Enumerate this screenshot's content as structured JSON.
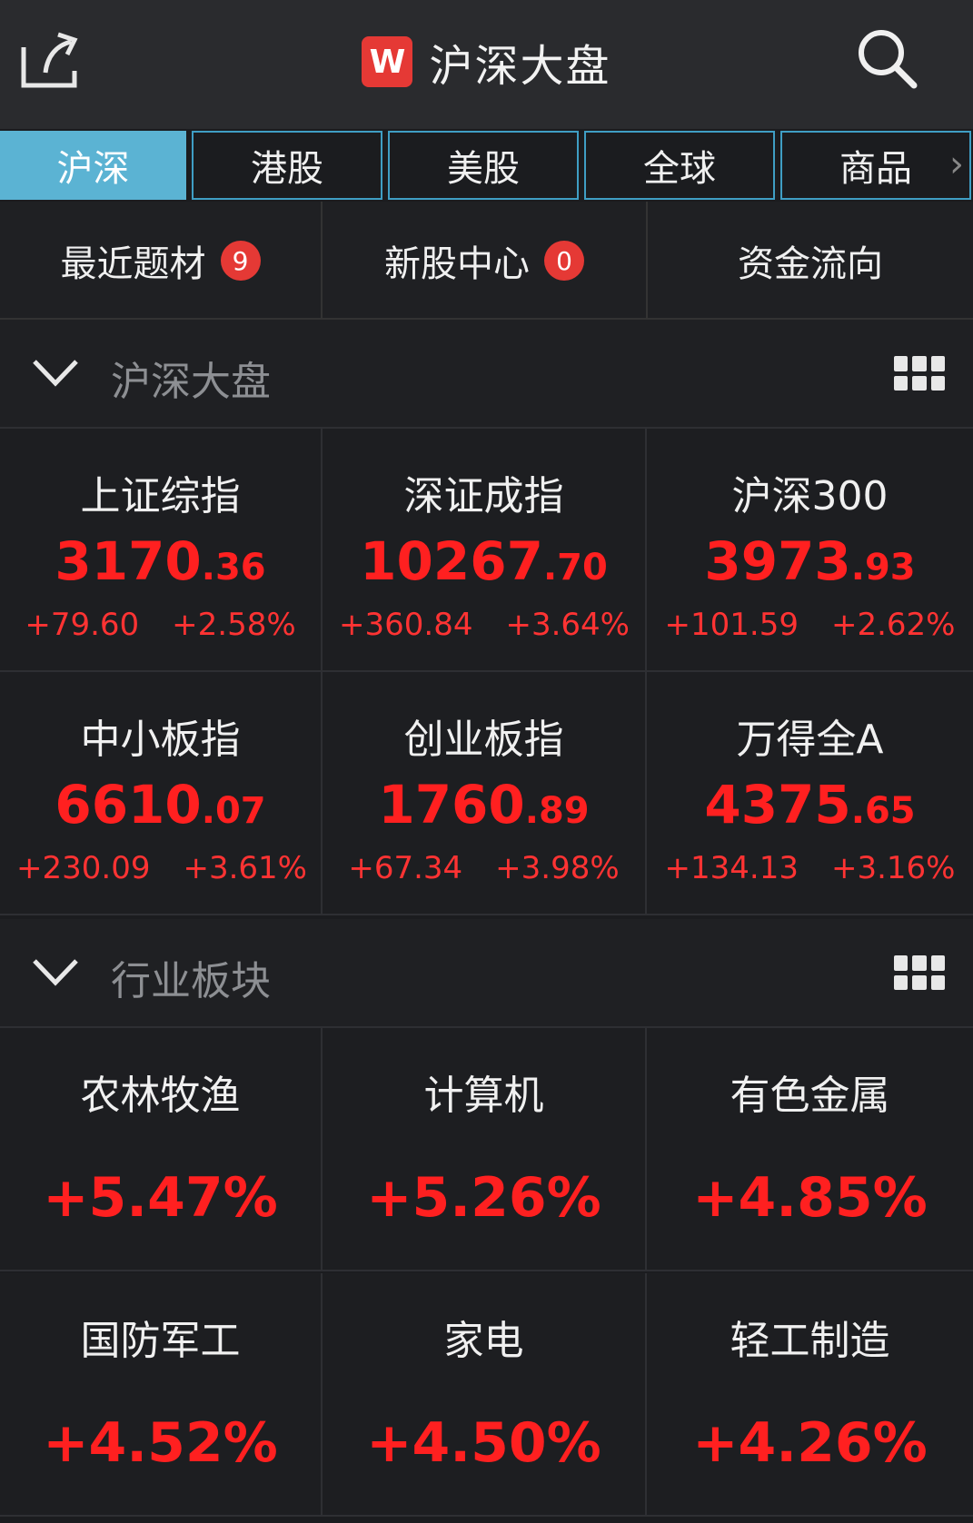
{
  "header": {
    "title": "沪深大盘",
    "logo_text": "W",
    "share_icon": "share-icon",
    "search_icon": "search-icon"
  },
  "tabs": [
    {
      "label": "沪深",
      "active": true
    },
    {
      "label": "港股",
      "active": false
    },
    {
      "label": "美股",
      "active": false
    },
    {
      "label": "全球",
      "active": false
    },
    {
      "label": "商品",
      "active": false
    }
  ],
  "quick_links": [
    {
      "label": "最近题材",
      "badge": "9"
    },
    {
      "label": "新股中心",
      "badge": "0"
    },
    {
      "label": "资金流向",
      "badge": null
    }
  ],
  "market_section": {
    "title": "沪深大盘",
    "indices": [
      {
        "name": "上证综指",
        "value_int": "3170",
        "value_dec": ".36",
        "change": "+79.60",
        "change_pct": "+2.58%"
      },
      {
        "name": "深证成指",
        "value_int": "10267",
        "value_dec": ".70",
        "change": "+360.84",
        "change_pct": "+3.64%"
      },
      {
        "name": "沪深300",
        "value_int": "3973",
        "value_dec": ".93",
        "change": "+101.59",
        "change_pct": "+2.62%"
      },
      {
        "name": "中小板指",
        "value_int": "6610",
        "value_dec": ".07",
        "change": "+230.09",
        "change_pct": "+3.61%"
      },
      {
        "name": "创业板指",
        "value_int": "1760",
        "value_dec": ".89",
        "change": "+67.34",
        "change_pct": "+3.98%"
      },
      {
        "name": "万得全A",
        "value_int": "4375",
        "value_dec": ".65",
        "change": "+134.13",
        "change_pct": "+3.16%"
      }
    ]
  },
  "industry_section": {
    "title": "行业板块",
    "sectors": [
      {
        "name": "农林牧渔",
        "pct": "+5.47%"
      },
      {
        "name": "计算机",
        "pct": "+5.26%"
      },
      {
        "name": "有色金属",
        "pct": "+4.85%"
      },
      {
        "name": "国防军工",
        "pct": "+4.52%"
      },
      {
        "name": "家电",
        "pct": "+4.50%"
      },
      {
        "name": "轻工制造",
        "pct": "+4.26%"
      }
    ]
  },
  "colors": {
    "up": "#ff2020",
    "tab_active": "#5bb3d3",
    "tab_border": "#3f9ec4",
    "badge": "#e53935"
  }
}
